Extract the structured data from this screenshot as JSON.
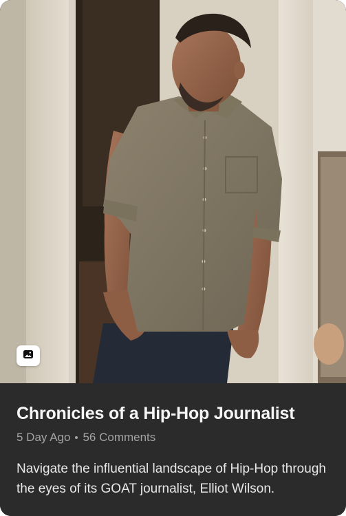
{
  "card": {
    "media": {
      "image_alt": "Man in olive button-up shirt leaning against a doorway",
      "badge_icon": "image-icon"
    },
    "title": "Chronicles of a Hip-Hop Journalist",
    "meta": {
      "posted": "5 Day Ago",
      "comments": "56 Comments"
    },
    "description": "Navigate the influential landscape of Hip-Hop through the eyes of its GOAT journalist, Elliot Wilson."
  },
  "colors": {
    "card_background": "#2b2b2c",
    "title": "#f5f5f5",
    "meta": "#a3a3a3",
    "description": "#e8e8e8"
  }
}
